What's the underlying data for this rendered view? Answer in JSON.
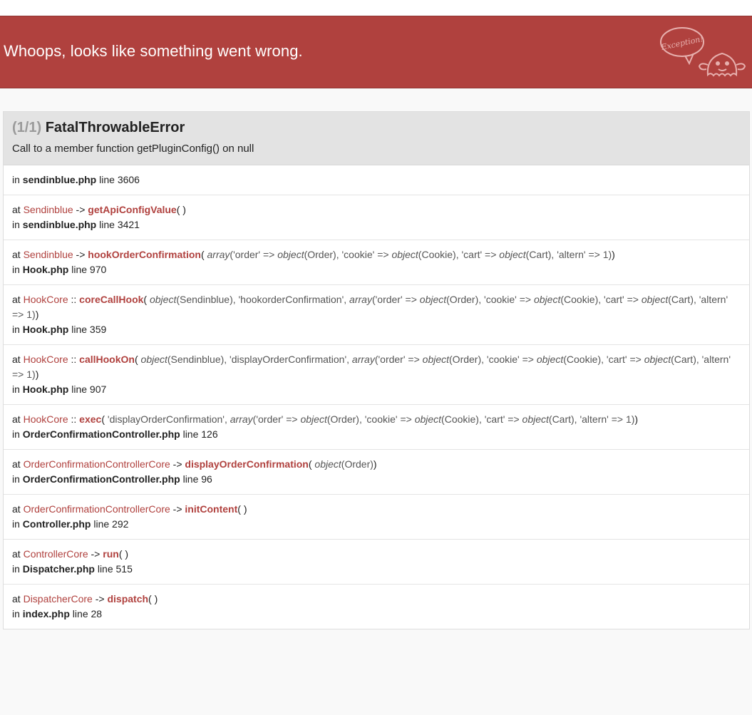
{
  "header": {
    "title": "Whoops, looks like something went wrong.",
    "mascot_text": "Exception!"
  },
  "exception": {
    "count": "(1/1)",
    "class": "FatalThrowableError",
    "message": "Call to a member function getPluginConfig() on null",
    "origin": {
      "prefix": "in",
      "file": "sendinblue.php",
      "line": "line 3606"
    }
  },
  "trace": [
    {
      "prefix": "at",
      "class": "Sendinblue",
      "sep": "->",
      "method": "getApiConfigValue",
      "args": [],
      "file": "sendinblue.php",
      "line": "line 3421"
    },
    {
      "prefix": "at",
      "class": "Sendinblue",
      "sep": "->",
      "method": "hookOrderConfirmation",
      "args": [
        {
          "t": "kw",
          "v": "array"
        },
        {
          "t": "arg",
          "v": "('order' => "
        },
        {
          "t": "kw",
          "v": "object"
        },
        {
          "t": "arg",
          "v": "(Order), 'cookie' => "
        },
        {
          "t": "kw",
          "v": "object"
        },
        {
          "t": "arg",
          "v": "(Cookie), 'cart' => "
        },
        {
          "t": "kw",
          "v": "object"
        },
        {
          "t": "arg",
          "v": "(Cart), 'altern' => 1)"
        }
      ],
      "file": "Hook.php",
      "line": "line 970"
    },
    {
      "prefix": "at",
      "class": "HookCore",
      "sep": "::",
      "method": "coreCallHook",
      "args": [
        {
          "t": "kw",
          "v": "object"
        },
        {
          "t": "arg",
          "v": "(Sendinblue), 'hookorderConfirmation', "
        },
        {
          "t": "kw",
          "v": "array"
        },
        {
          "t": "arg",
          "v": "('order' => "
        },
        {
          "t": "kw",
          "v": "object"
        },
        {
          "t": "arg",
          "v": "(Order), 'cookie' => "
        },
        {
          "t": "kw",
          "v": "object"
        },
        {
          "t": "arg",
          "v": "(Cookie), 'cart' => "
        },
        {
          "t": "kw",
          "v": "object"
        },
        {
          "t": "arg",
          "v": "(Cart), 'altern' => 1)"
        }
      ],
      "file": "Hook.php",
      "line": "line 359"
    },
    {
      "prefix": "at",
      "class": "HookCore",
      "sep": "::",
      "method": "callHookOn",
      "args": [
        {
          "t": "kw",
          "v": "object"
        },
        {
          "t": "arg",
          "v": "(Sendinblue), 'displayOrderConfirmation', "
        },
        {
          "t": "kw",
          "v": "array"
        },
        {
          "t": "arg",
          "v": "('order' => "
        },
        {
          "t": "kw",
          "v": "object"
        },
        {
          "t": "arg",
          "v": "(Order), 'cookie' => "
        },
        {
          "t": "kw",
          "v": "object"
        },
        {
          "t": "arg",
          "v": "(Cookie), 'cart' => "
        },
        {
          "t": "kw",
          "v": "object"
        },
        {
          "t": "arg",
          "v": "(Cart), 'altern' => 1)"
        }
      ],
      "file": "Hook.php",
      "line": "line 907"
    },
    {
      "prefix": "at",
      "class": "HookCore",
      "sep": "::",
      "method": "exec",
      "args": [
        {
          "t": "arg",
          "v": "'displayOrderConfirmation', "
        },
        {
          "t": "kw",
          "v": "array"
        },
        {
          "t": "arg",
          "v": "('order' => "
        },
        {
          "t": "kw",
          "v": "object"
        },
        {
          "t": "arg",
          "v": "(Order), 'cookie' => "
        },
        {
          "t": "kw",
          "v": "object"
        },
        {
          "t": "arg",
          "v": "(Cookie), 'cart' => "
        },
        {
          "t": "kw",
          "v": "object"
        },
        {
          "t": "arg",
          "v": "(Cart), 'altern' => 1)"
        }
      ],
      "file": "OrderConfirmationController.php",
      "line": "line 126"
    },
    {
      "prefix": "at",
      "class": "OrderConfirmationControllerCore",
      "sep": "->",
      "method": "displayOrderConfirmation",
      "args": [
        {
          "t": "kw",
          "v": "object"
        },
        {
          "t": "arg",
          "v": "(Order)"
        }
      ],
      "file": "OrderConfirmationController.php",
      "line": "line 96"
    },
    {
      "prefix": "at",
      "class": "OrderConfirmationControllerCore",
      "sep": "->",
      "method": "initContent",
      "args": [],
      "file": "Controller.php",
      "line": "line 292"
    },
    {
      "prefix": "at",
      "class": "ControllerCore",
      "sep": "->",
      "method": "run",
      "args": [],
      "file": "Dispatcher.php",
      "line": "line 515"
    },
    {
      "prefix": "at",
      "class": "DispatcherCore",
      "sep": "->",
      "method": "dispatch",
      "args": [],
      "file": "index.php",
      "line": "line 28"
    }
  ]
}
